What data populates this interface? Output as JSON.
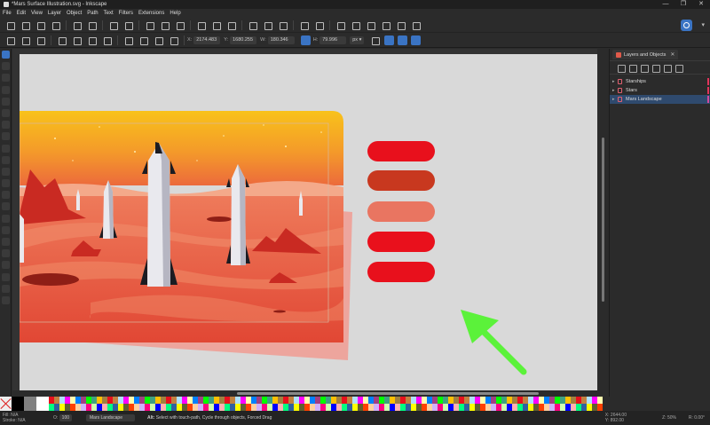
{
  "window": {
    "title": "*Mars Surface Illustration.svg - Inkscape",
    "controls": [
      "—",
      "❐",
      "✕"
    ]
  },
  "menubar": [
    "File",
    "Edit",
    "View",
    "Layer",
    "Object",
    "Path",
    "Text",
    "Filters",
    "Extensions",
    "Help"
  ],
  "toolbar": {
    "x": "2174.483",
    "y": "1680.255",
    "w": "180.346",
    "h": "79.996",
    "x_label": "X:",
    "y_label": "Y:",
    "w_label": "W:",
    "h_label": "H:",
    "unit": "px"
  },
  "panel": {
    "title": "Layers and Objects",
    "layers": [
      {
        "name": "Starships",
        "selected": false
      },
      {
        "name": "Stars",
        "selected": false
      },
      {
        "name": "Mars Landscape",
        "selected": true
      }
    ]
  },
  "canvas": {
    "background": "#d9d9d9",
    "swatches": [
      "#e8101c",
      "#c8381f",
      "#e97561",
      "#e9101c",
      "#e8101c"
    ],
    "arrow_color": "#5bf23a",
    "sky_top": "#f8c21a",
    "ground": "#e85a40"
  },
  "status": {
    "fill_label": "Fill:",
    "fill_value": "N/A",
    "stroke_label": "Stroke:",
    "stroke_value": "N/A",
    "opacity_label": "O:",
    "opacity_value": "100",
    "current_layer": "Mars Landscape",
    "hint_bold": "Alt:",
    "hint": " Select with touch-path, Cycle through objects, Forced Drag",
    "x_label": "X:",
    "x": "2644.00",
    "y_label": "Y:",
    "y": "892.00",
    "zoom_label": "Z:",
    "zoom": "50%",
    "rotation_label": "R:",
    "rotation": "0.00°"
  }
}
